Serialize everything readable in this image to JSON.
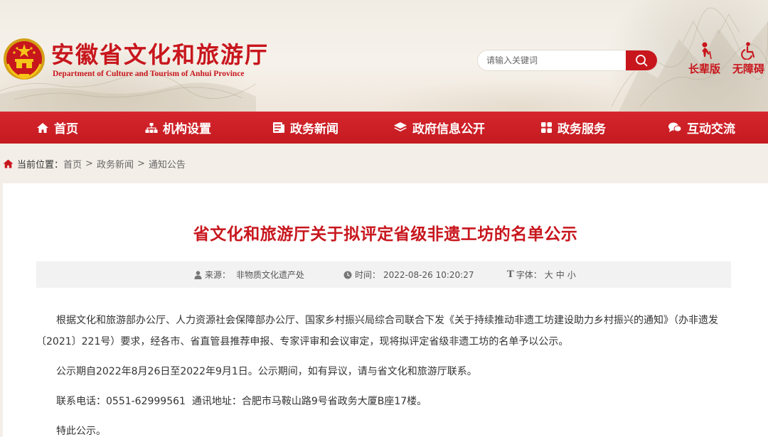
{
  "header": {
    "site_title": "安徽省文化和旅游厅",
    "site_subtitle": "Department of Culture and Tourism of Anhui Province",
    "search": {
      "placeholder": "请输入关键词"
    },
    "tools": {
      "elder_label": "长辈版",
      "access_label": "无障碍"
    }
  },
  "nav": {
    "items": [
      {
        "label": "首页",
        "icon": "home-icon"
      },
      {
        "label": "机构设置",
        "icon": "org-chart-icon"
      },
      {
        "label": "政务新闻",
        "icon": "news-icon"
      },
      {
        "label": "政府信息公开",
        "icon": "layers-icon"
      },
      {
        "label": "政务服务",
        "icon": "grid-icon"
      },
      {
        "label": "互动交流",
        "icon": "chat-icon"
      }
    ]
  },
  "breadcrumb": {
    "label": "当前位置：",
    "items": [
      "首页",
      "政务新闻",
      "通知公告"
    ],
    "separator": ">"
  },
  "article": {
    "title": "省文化和旅游厅关于拟评定省级非遗工坊的名单公示",
    "meta": {
      "source_label": "来源：",
      "source": "非物质文化遗产处",
      "time_label": "时间：",
      "time": "2022-08-26 10:20:27",
      "font_label": "字体：",
      "font_sizes": [
        "大",
        "中",
        "小"
      ]
    },
    "paragraphs": [
      "根据文化和旅游部办公厅、人力资源社会保障部办公厅、国家乡村振兴局综合司联合下发《关于持续推动非遗工坊建设助力乡村振兴的通知》（办非遗发〔2021〕221号）要求，经各市、省直管县推荐申报、专家评审和会议审定，现将拟评定省级非遗工坊的名单予以公示。",
      "公示期自2022年8月26日至2022年9月1日。公示期间，如有异议，请与省文化和旅游厅联系。",
      "联系电话：0551-62999561  通讯地址：合肥市马鞍山路9号省政务大厦B座17楼。",
      "特此公示。"
    ]
  },
  "colors": {
    "brand_red": "#c8161d",
    "nav_red": "#cf2128",
    "page_bg": "#f3efe8"
  }
}
